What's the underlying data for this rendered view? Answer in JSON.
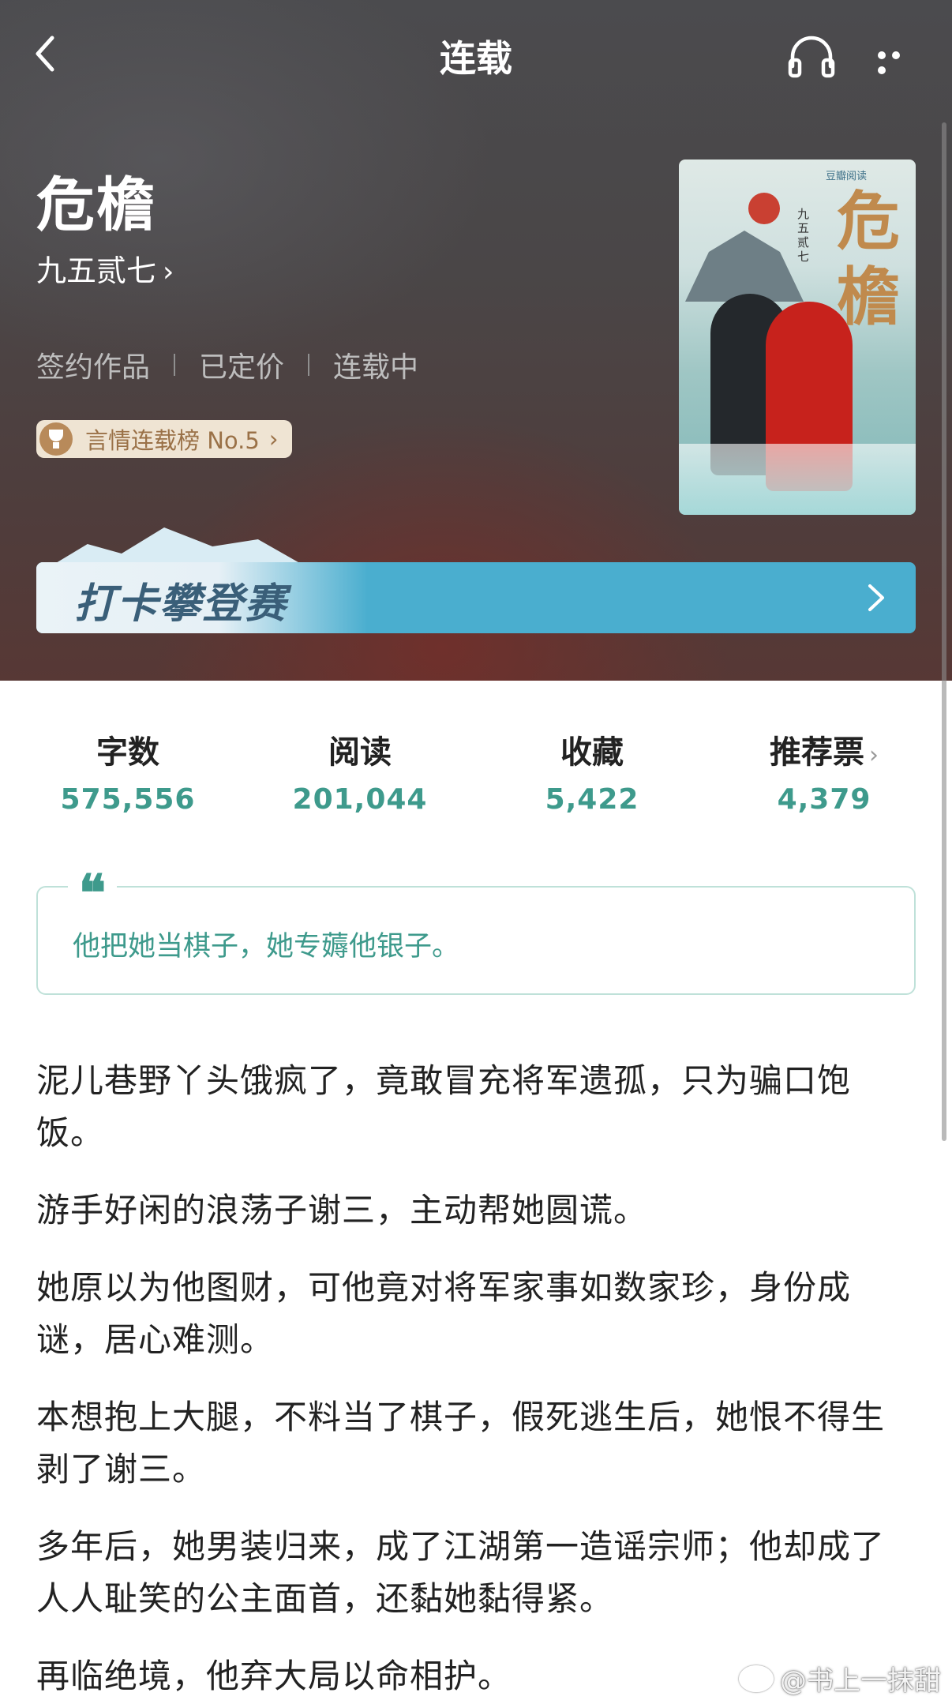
{
  "nav": {
    "title": "连载",
    "icons": [
      "back-icon",
      "headphones-icon",
      "more-icon"
    ]
  },
  "book": {
    "title": "危檐",
    "author": "九五贰七",
    "author_chevron": "›",
    "tags": [
      "签约作品",
      "已定价",
      "连载中"
    ],
    "rank": "言情连载榜 No.5",
    "rank_chevron": "›"
  },
  "cover": {
    "title_char1": "危",
    "title_char2": "檐",
    "author_vertical": "九五贰七",
    "logo": "豆瓣阅读"
  },
  "banner": {
    "text": "打卡攀登赛"
  },
  "stats": [
    {
      "label": "字数",
      "value": "575,556"
    },
    {
      "label": "阅读",
      "value": "201,044"
    },
    {
      "label": "收藏",
      "value": "5,422"
    },
    {
      "label": "推荐票",
      "value": "4,379"
    }
  ],
  "stat_chevron": "›",
  "quote": {
    "mark": "❝",
    "text": "他把她当棋子，她专薅他银子。"
  },
  "synopsis": [
    "泥儿巷野丫头饿疯了，竟敢冒充将军遗孤，只为骗口饱饭。",
    "游手好闲的浪荡子谢三，主动帮她圆谎。",
    "她原以为他图财，可他竟对将军家事如数家珍，身份成谜，居心难测。",
    "本想抱上大腿，不料当了棋子，假死逃生后，她恨不得生剥了谢三。",
    "多年后，她男装归来，成了江湖第一造谣宗师；他却成了人人耻笑的公主面首，还黏她黏得紧。",
    "再临绝境，他弃大局以命相护。"
  ],
  "watermark": "@书上一抹甜",
  "colors": {
    "accent": "#3e9a8c",
    "banner": "#4aaecf",
    "rank_bg": "#efe4d3",
    "rank_text": "#9a7147"
  }
}
